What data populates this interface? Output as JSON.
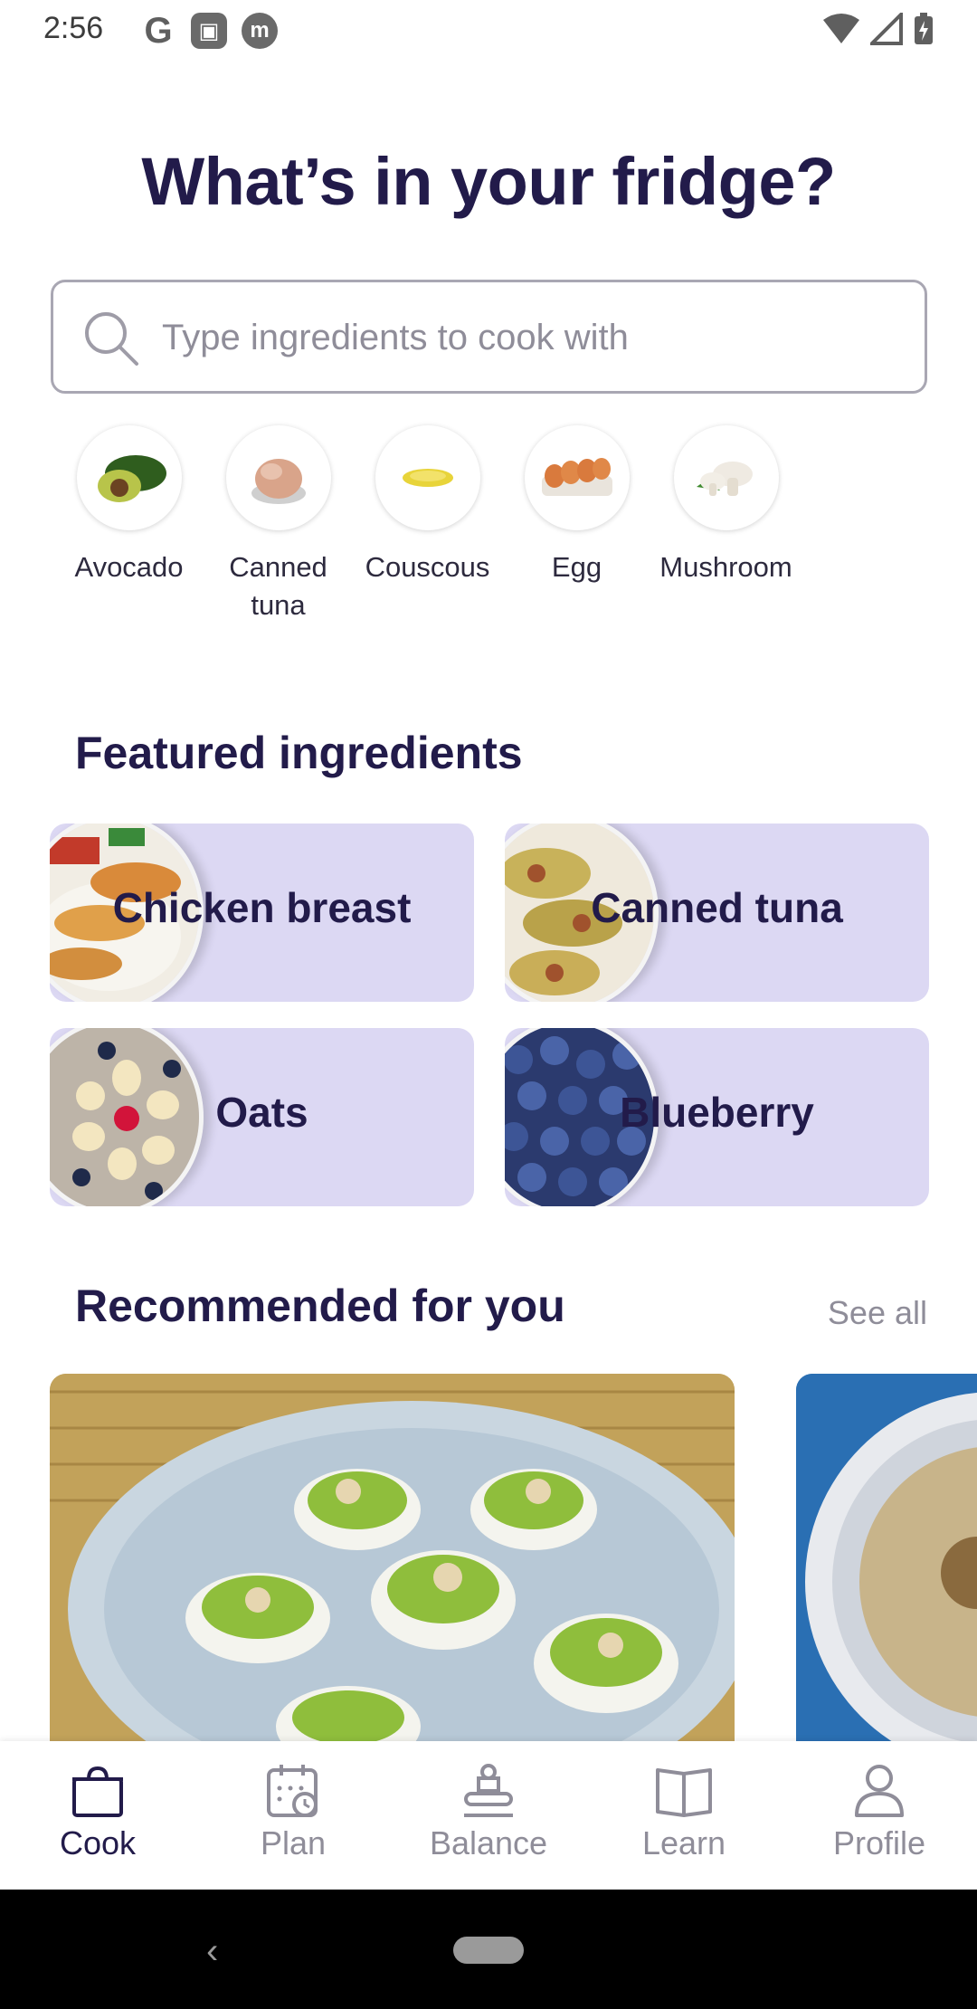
{
  "status_bar": {
    "time": "2:56",
    "left_icons": [
      "google-icon",
      "screen-icon",
      "m-icon"
    ],
    "right_icons": [
      "wifi-icon",
      "signal-icon",
      "battery-icon"
    ]
  },
  "page_title": "What’s in your fridge?",
  "search": {
    "placeholder": "Type ingredients to cook with",
    "value": ""
  },
  "quick_ingredients": [
    {
      "label": "Avocado"
    },
    {
      "label": "Canned\ntuna"
    },
    {
      "label": "Couscous"
    },
    {
      "label": "Egg"
    },
    {
      "label": "Mushroom"
    }
  ],
  "featured": {
    "title": "Featured ingredients",
    "cards": [
      {
        "label": "Chicken breast"
      },
      {
        "label": "Canned tuna"
      },
      {
        "label": "Oats"
      },
      {
        "label": "Blueberry"
      }
    ]
  },
  "recommended": {
    "title": "Recommended for you",
    "see_all": "See all"
  },
  "bottom_nav": [
    {
      "label": "Cook",
      "active": true
    },
    {
      "label": "Plan",
      "active": false
    },
    {
      "label": "Balance",
      "active": false
    },
    {
      "label": "Learn",
      "active": false
    },
    {
      "label": "Profile",
      "active": false
    }
  ],
  "colors": {
    "accent_dark": "#221b4a",
    "card_bg": "#dcd8f3",
    "muted": "#8f8d99"
  }
}
